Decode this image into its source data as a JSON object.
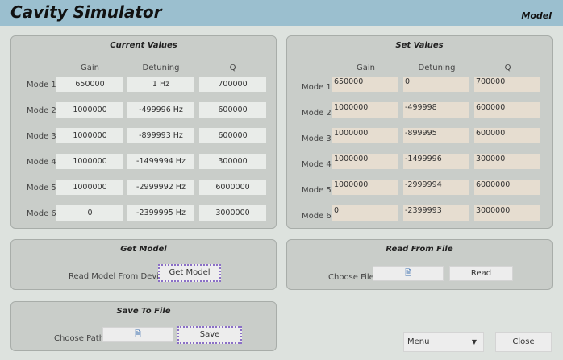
{
  "header": {
    "title": "Cavity Simulator",
    "right_label": "Model"
  },
  "current": {
    "title": "Current Values",
    "columns": [
      "Gain",
      "Detuning",
      "Q"
    ],
    "rows": [
      {
        "label": "Mode 1",
        "gain": "650000",
        "detuning": "1 Hz",
        "q": "700000"
      },
      {
        "label": "Mode 2",
        "gain": "1000000",
        "detuning": "-499996 Hz",
        "q": "600000"
      },
      {
        "label": "Mode 3",
        "gain": "1000000",
        "detuning": "-899993 Hz",
        "q": "600000"
      },
      {
        "label": "Mode 4",
        "gain": "1000000",
        "detuning": "-1499994 Hz",
        "q": "300000"
      },
      {
        "label": "Mode 5",
        "gain": "1000000",
        "detuning": "-2999992 Hz",
        "q": "6000000"
      },
      {
        "label": "Mode 6",
        "gain": "0",
        "detuning": "-2399995 Hz",
        "q": "3000000"
      }
    ]
  },
  "set": {
    "title": "Set Values",
    "columns": [
      "Gain",
      "Detuning",
      "Q"
    ],
    "rows": [
      {
        "label": "Mode 1",
        "gain": "650000",
        "detuning": "0",
        "q": "700000"
      },
      {
        "label": "Mode 2",
        "gain": "1000000",
        "detuning": "-499998",
        "q": "600000"
      },
      {
        "label": "Mode 3",
        "gain": "1000000",
        "detuning": "-899995",
        "q": "600000"
      },
      {
        "label": "Mode 4",
        "gain": "1000000",
        "detuning": "-1499996",
        "q": "300000"
      },
      {
        "label": "Mode 5",
        "gain": "1000000",
        "detuning": "-2999994",
        "q": "6000000"
      },
      {
        "label": "Mode 6",
        "gain": "0",
        "detuning": "-2399993",
        "q": "3000000"
      }
    ]
  },
  "get_model": {
    "title": "Get Model",
    "label": "Read Model From Device",
    "button": "Get Model"
  },
  "read_file": {
    "title": "Read From File",
    "label": "Choose File",
    "file_icon": "file-icon",
    "button": "Read"
  },
  "save_file": {
    "title": "Save To File",
    "label": "Choose Path",
    "file_icon": "file-icon",
    "button": "Save"
  },
  "footer": {
    "menu": "Menu",
    "close": "Close"
  }
}
